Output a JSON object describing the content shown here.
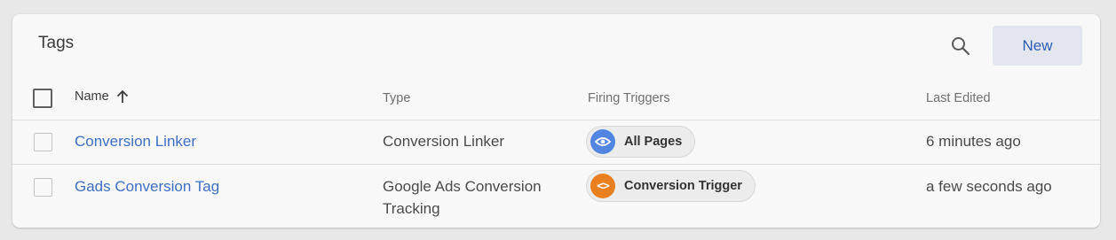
{
  "panel": {
    "title": "Tags",
    "new_label": "New"
  },
  "columns": {
    "name": "Name",
    "type": "Type",
    "firing_triggers": "Firing Triggers",
    "last_edited": "Last Edited"
  },
  "rows": [
    {
      "name": "Conversion Linker",
      "type": "Conversion Linker",
      "trigger": "All Pages",
      "trigger_icon": "eye-icon",
      "last_edited": "6 minutes ago"
    },
    {
      "name": "Gads Conversion Tag",
      "type_line1": "Google Ads Conversion",
      "type_line2": "Tracking",
      "trigger": "Conversion Trigger",
      "trigger_icon": "code-icon",
      "last_edited": "a few seconds ago"
    }
  ],
  "colors": {
    "link": "#3d6fc4",
    "new_button_bg": "#e3e6ee",
    "trigger_blue": "#5185e0",
    "trigger_orange": "#e97f1e"
  }
}
